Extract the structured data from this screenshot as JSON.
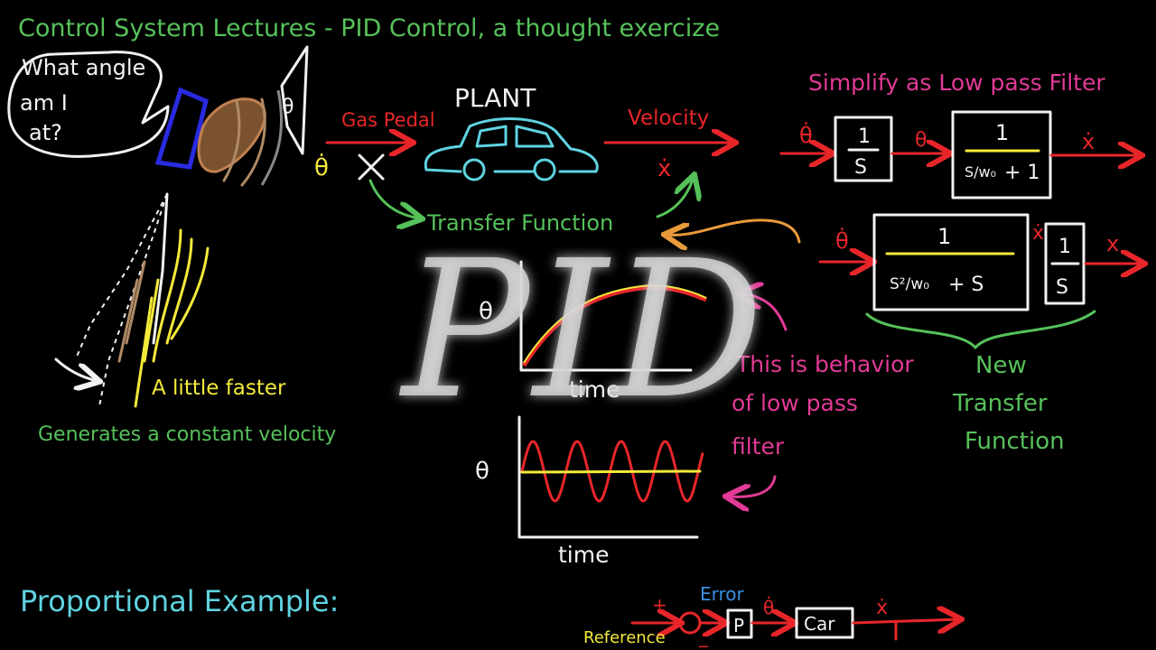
{
  "title": "Control System Lectures - PID Control, a thought exercize",
  "watermark": "PID",
  "bubble": {
    "line1": "What angle",
    "line2": "am I",
    "line3": "at?"
  },
  "plant": {
    "gas_pedal": "Gas Pedal",
    "plant": "PLANT",
    "velocity": "Velocity",
    "transfer_function": "Transfer Function",
    "input_symbol": "θ̇",
    "output_symbol": "ẋ"
  },
  "left": {
    "faster": "A little faster",
    "generates": "Generates a constant velocity"
  },
  "right": {
    "simplify": "Simplify as Low pass Filter",
    "one": "1",
    "s": "S",
    "s_over_w0": "S/w₀",
    "plus_one": "+ 1",
    "s2_over_w0": "S²/w₀",
    "plus_s": "+ S",
    "theta": "θ",
    "theta_dot": "θ̇",
    "x_dot": "ẋ",
    "x": "x",
    "new_tf_1": "New",
    "new_tf_2": "Transfer",
    "new_tf_3": "Function"
  },
  "plots": {
    "theta": "θ",
    "time1": "time",
    "time2": "time",
    "note1": "This is behavior",
    "note2": "of low pass",
    "note3": "filter"
  },
  "bottom": {
    "prop": "Proportional Example:",
    "error": "Error",
    "reference": "Reference",
    "p": "P",
    "car": "Car",
    "plus": "+",
    "minus": "_",
    "theta_dot": "θ̇",
    "x_dot": "ẋ"
  }
}
